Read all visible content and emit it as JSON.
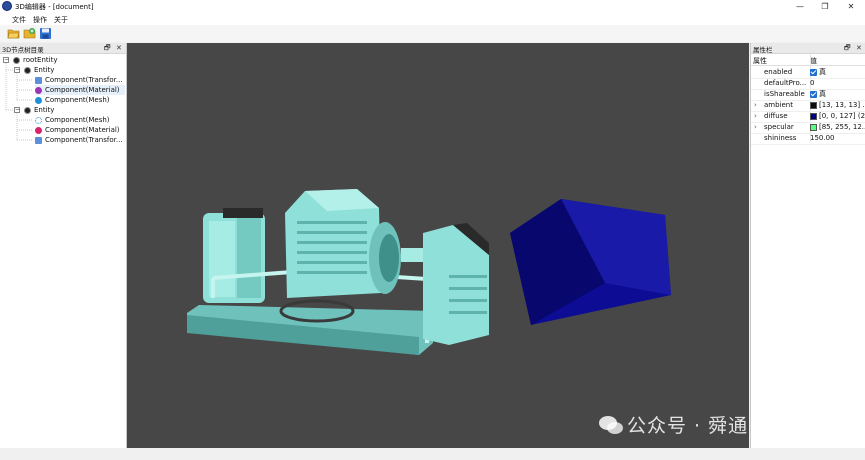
{
  "window": {
    "title": "3D编辑器 - [document]",
    "controls": {
      "minimize": "—",
      "restore": "❐",
      "close": "✕"
    }
  },
  "menu": [
    "文件",
    "操作",
    "关于"
  ],
  "toolbar": [
    {
      "icon": "open-folder-icon"
    },
    {
      "icon": "add-file-icon"
    },
    {
      "icon": "save-icon"
    }
  ],
  "left_panel": {
    "title": "3D节点树目录",
    "float_btn": "🗗",
    "close_btn": "✕",
    "tree": [
      {
        "label": "rootEntity",
        "level": 0,
        "icon": "entity-icon",
        "expander": "−"
      },
      {
        "label": "Entity",
        "level": 1,
        "icon": "entity-icon",
        "expander": "−"
      },
      {
        "label": "Component(Transfor...",
        "level": 2,
        "icon": "transform-icon"
      },
      {
        "label": "Component(Material)",
        "level": 2,
        "icon": "material-icon",
        "selected": true
      },
      {
        "label": "Component(Mesh)",
        "level": 2,
        "icon": "mesh-icon"
      },
      {
        "label": "Entity",
        "level": 1,
        "icon": "entity-icon",
        "expander": "−"
      },
      {
        "label": "Component(Mesh)",
        "level": 2,
        "icon": "mesh-outline-icon"
      },
      {
        "label": "Component(Material)",
        "level": 2,
        "icon": "material-icon-2"
      },
      {
        "label": "Component(Transfor...",
        "level": 2,
        "icon": "transform-icon"
      }
    ]
  },
  "right_panel": {
    "title": "属性栏",
    "float_btn": "🗗",
    "close_btn": "✕",
    "columns": {
      "name": "属性",
      "value": "值"
    },
    "properties": [
      {
        "name": "enabled",
        "type": "check",
        "value": "真"
      },
      {
        "name": "defaultPro...",
        "type": "text",
        "value": "0"
      },
      {
        "name": "isShareable",
        "type": "check",
        "value": "真"
      },
      {
        "name": "ambient",
        "type": "color",
        "color": "#0d0d0d",
        "value": "[13, 13, 13] ...",
        "arrow": "›"
      },
      {
        "name": "diffuse",
        "type": "color",
        "color": "#00007f",
        "value": "[0, 0, 127] (2...",
        "arrow": "›"
      },
      {
        "name": "specular",
        "type": "color",
        "color": "#55ff7f",
        "value": "[85, 255, 12...",
        "arrow": "›"
      },
      {
        "name": "shininess",
        "type": "text",
        "value": "150.00"
      }
    ]
  },
  "viewport": {
    "background": "#474747",
    "machine_color": "#8fe0d8",
    "cube_color": "#0a0a8c"
  },
  "watermark": "公众号 · 舜通智能"
}
